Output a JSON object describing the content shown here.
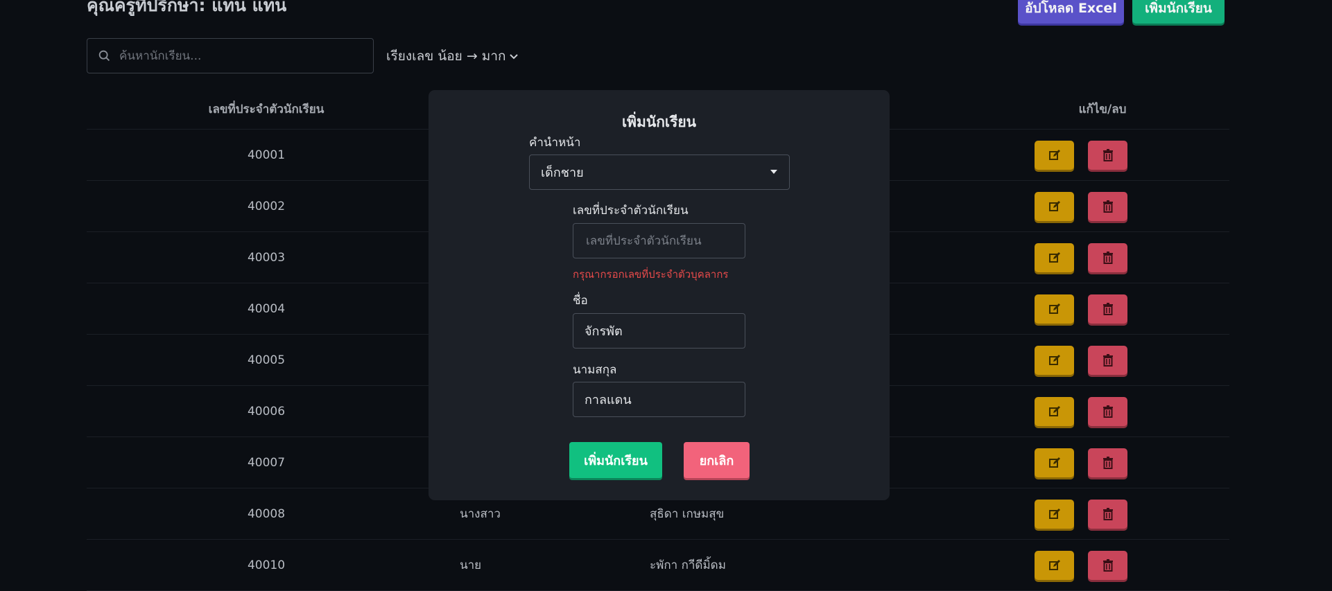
{
  "header": {
    "title": "คุณครูที่ปรึกษา: แทน แทน",
    "upload_label": "อัปโหลด Excel",
    "add_label": "เพิ่มนักเรียน"
  },
  "search": {
    "placeholder": "ค้นหานักเรียน..."
  },
  "sort": {
    "label": "เรียงเลข น้อย → มาก"
  },
  "table": {
    "col_id": "เลขที่ประจำตัวนักเรียน",
    "col_actions": "แก้ไข/ลบ",
    "rows": [
      {
        "id": "40001",
        "prefix": "",
        "name": ""
      },
      {
        "id": "40002",
        "prefix": "",
        "name": ""
      },
      {
        "id": "40003",
        "prefix": "",
        "name": ""
      },
      {
        "id": "40004",
        "prefix": "",
        "name": ""
      },
      {
        "id": "40005",
        "prefix": "",
        "name": ""
      },
      {
        "id": "40006",
        "prefix": "",
        "name": ""
      },
      {
        "id": "40007",
        "prefix": "",
        "name": ""
      },
      {
        "id": "40008",
        "prefix": "นางสาว",
        "name": "สุธิดา เกษมสุข"
      },
      {
        "id": "40010",
        "prefix": "นาย",
        "name": "ะพักา กาีดีมิ้ดม"
      }
    ]
  },
  "modal": {
    "title": "เพิ่มนักเรียน",
    "prefix_label": "คำนำหน้า",
    "prefix_value": "เด็กชาย",
    "id_label": "เลขที่ประจำตัวนักเรียน",
    "id_placeholder": "เลขที่ประจำตัวนักเรียน",
    "id_error": "กรุณากรอกเลขที่ประจำตัวบุคลากร",
    "first_label": "ชื่อ",
    "first_value": "จักรพัต",
    "last_label": "นามสกุล",
    "last_value": "กาลแดน",
    "submit_label": "เพิ่มนักเรียน",
    "cancel_label": "ยกเลิก"
  }
}
